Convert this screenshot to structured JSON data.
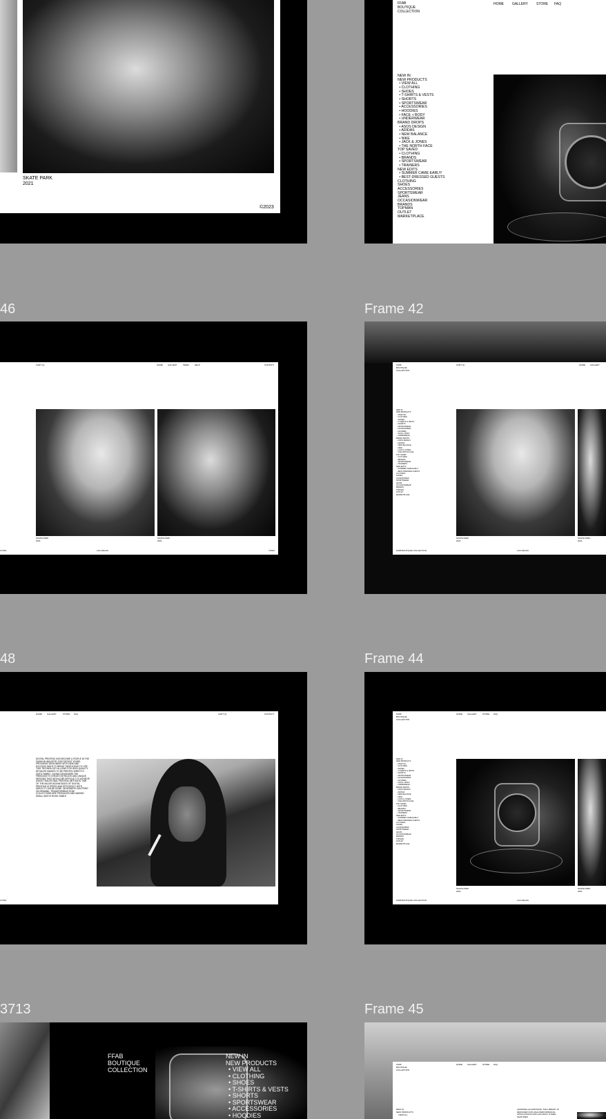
{
  "canvas": {
    "background": "#9b9b9b"
  },
  "frames": {
    "frame_top_left": {
      "caption_title": "SKATE PARK",
      "caption_year": "2021",
      "copyright": "©2023"
    },
    "frame_top_right": {
      "brand": [
        "FFAB",
        "BOUTIQUE",
        "COLLECTION"
      ],
      "nav": [
        "HOME",
        "GALLERY",
        "STORE",
        "FAQ"
      ],
      "menu": [
        {
          "label": "NEW IN",
          "sub": false
        },
        {
          "label": "NEW PRODUCTS",
          "sub": false
        },
        {
          "label": "VIEW ALL",
          "sub": true
        },
        {
          "label": "CLOTHING",
          "sub": true
        },
        {
          "label": "SHOES",
          "sub": true
        },
        {
          "label": "T-SHIRTS & VESTS",
          "sub": true
        },
        {
          "label": "SHORTS",
          "sub": true
        },
        {
          "label": "SPORTSWEAR",
          "sub": true
        },
        {
          "label": "ACCESSORIES",
          "sub": true
        },
        {
          "label": "HOODIES",
          "sub": true
        },
        {
          "label": "FACE + BODY",
          "sub": true
        },
        {
          "label": "UNDERWEAR",
          "sub": true
        },
        {
          "label": "BRAND DROPS",
          "sub": false
        },
        {
          "label": "ASOS DESIGN",
          "sub": true
        },
        {
          "label": "ADIDAS",
          "sub": true
        },
        {
          "label": "NEW BALANCE",
          "sub": true
        },
        {
          "label": "NIKE",
          "sub": true
        },
        {
          "label": "JACK & JONES",
          "sub": true
        },
        {
          "label": "THE NORTH FACE",
          "sub": true
        },
        {
          "label": "TOP SAVED",
          "sub": false
        },
        {
          "label": "CLOTHING",
          "sub": true
        },
        {
          "label": "BRANDS",
          "sub": true
        },
        {
          "label": "SPORTSWEAR",
          "sub": true
        },
        {
          "label": "TRAINERS",
          "sub": true
        },
        {
          "label": "NEW EDITS",
          "sub": false
        },
        {
          "label": "SUMMER CAME EARLY!",
          "sub": true
        },
        {
          "label": "BEST-DRESSED GUESTS",
          "sub": true
        },
        {
          "label": "CLOTHING",
          "sub": false
        },
        {
          "label": "SHOES",
          "sub": false
        },
        {
          "label": "ACCESSORIES",
          "sub": false
        },
        {
          "label": "SPORTSWEAR",
          "sub": false
        },
        {
          "label": "JEANS",
          "sub": false
        },
        {
          "label": "OCCASIONWEAR",
          "sub": false
        },
        {
          "label": "BRANDS",
          "sub": false
        },
        {
          "label": "TOPMAN",
          "sub": false
        },
        {
          "label": "OUTLET",
          "sub": false
        },
        {
          "label": "MARKETPLACE",
          "sub": false
        }
      ]
    },
    "frame_46": {
      "label": "46",
      "cart": "CART (1)",
      "nav": [
        "HOME",
        "GALLERY",
        "INDEX",
        "HELP"
      ],
      "contact": "CONTACT",
      "caption1_title": "SKATE PARK",
      "caption1_year": "2021",
      "caption2_title": "SKATE PARK",
      "caption2_year": "2021",
      "footer_left": "CTION",
      "footer_mid": "LAS VEGAS",
      "footer_right": "©2023"
    },
    "frame_42": {
      "label": "Frame 42",
      "brand": [
        "FFAB",
        "BOUTIQUE",
        "COLLECTION"
      ],
      "cart": "CART (1)",
      "nav": [
        "HOME",
        "GALLERY"
      ],
      "caption1_title": "SKATE PARK",
      "caption1_year": "2021",
      "caption2_title": "SKATE PARK",
      "caption2_year": "2021",
      "footer_left": "FFAB BOUTIQUE COLLECTION",
      "footer_mid": "LAS VEGAS"
    },
    "frame_48": {
      "label": "48",
      "nav": [
        "HOME",
        "GALLERY",
        "STORE",
        "FAQ"
      ],
      "cart": "CART (1)",
      "contact": "CONTACT",
      "body": "DIGITAL PRINTING HAS BECOME A STAPLE IN THE FASHION INDUSTRY FOR RECENT YEARS, PROVIDING DESIGNERS WITH NEW AND EXCITING WAYS TO BRING THEIR IDEAS TO LIFE. THIS TECHNOLOGY ALLOWS FOR HIGH-QUALITY, DETAILED IMAGES TO BE PRINTED DIRECTLY ONTO FABRIC, GIVING DESIGNERS THE FREEDOM TO CREATE INTRICATE AND UNIQUE DESIGNS THAT WOULD BE DIFFICULT TO ACHIEVE USING TRADITIONAL PRINTING METHODS. ONE OF THE MAJOR ADVANTAGES OF DIGITAL PRINTING IS SPEED AND EFFICIENCY WITH WHICH IT CAN BE DONE. DESIGNERS CAN PRINT ON DEMAND, TRANSFORMING HOW COLLECTIONS ARE PRODUCED AND MAKING SMALL-BATCH RUNS VIABLE.",
      "footer_left": "CTION"
    },
    "frame_44": {
      "label": "Frame 44",
      "brand": [
        "FFAB",
        "BOUTIQUE",
        "COLLECTION"
      ],
      "nav": [
        "HOME",
        "GALLERY",
        "STORE",
        "FAQ"
      ],
      "caption1_title": "SKATE PARK",
      "caption1_year": "2021",
      "caption2_title": "SKATE PARK",
      "caption2_year": "2021",
      "footer_left": "FFAB BOUTIQUE COLLECTION",
      "footer_mid": "LAS VEGAS"
    },
    "frame_3713": {
      "label": "3713",
      "brand": [
        "FFAB",
        "BOUTIQUE",
        "COLLECTION"
      ],
      "menu": [
        {
          "label": "NEW IN",
          "sub": false
        },
        {
          "label": "NEW PRODUCTS",
          "sub": false
        },
        {
          "label": "VIEW ALL",
          "sub": true
        },
        {
          "label": "CLOTHING",
          "sub": true
        },
        {
          "label": "SHOES",
          "sub": true
        },
        {
          "label": "T-SHIRTS & VESTS",
          "sub": true
        },
        {
          "label": "SHORTS",
          "sub": true
        },
        {
          "label": "SPORTSWEAR",
          "sub": true
        },
        {
          "label": "ACCESSORIES",
          "sub": true
        },
        {
          "label": "HOODIES",
          "sub": true
        }
      ]
    },
    "frame_45": {
      "label": "Frame 45",
      "brand": [
        "FFAB",
        "BOUTIQUE",
        "COLLECTION"
      ],
      "nav": [
        "HOME",
        "GALLERY",
        "STORE",
        "FAQ"
      ],
      "menu_head": [
        "NEW IN",
        "NEW PRODUCTS",
        "VIEW ALL"
      ],
      "body": "LEARNING ALGORITHMS, THE LIBRARY IS DESIGNED FOR HIGH-PERFORMANCE APPLICATIONS AND HAS MANY OTHER FEATURES"
    }
  }
}
